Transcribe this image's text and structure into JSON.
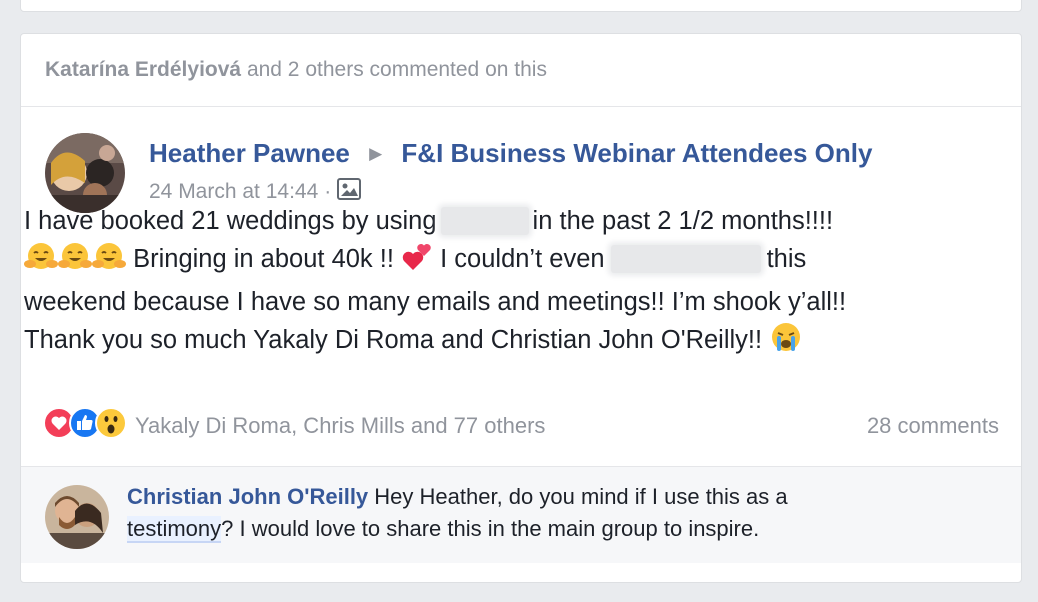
{
  "activity": {
    "actor": "Katarína Erdélyiová",
    "suffix": "and 2 others commented on this"
  },
  "post": {
    "author": "Heather Pawnee",
    "group": "F&I Business Webinar Attendees Only",
    "timestamp": "24 March at 14:44",
    "separator": "·",
    "privacy_icon": "photo-privacy-icon",
    "text": {
      "part1": "I have booked 21 weddings by using",
      "part2": "in the past 2 1/2 months!!!!",
      "part3": "Bringing in about 40k !!",
      "part4": "I couldn’t even",
      "part5": "this",
      "part6": "weekend because I have so many emails and meetings!! I’m shook y’all!!",
      "part7": "Thank you so much Yakaly Di Roma and Christian John O'Reilly!!"
    }
  },
  "reactions": {
    "icons": [
      "love-reaction-icon",
      "like-reaction-icon",
      "wow-reaction-icon"
    ],
    "names": "Yakaly Di Roma, Chris Mills and 77 others",
    "comments": "28 comments"
  },
  "comment": {
    "author": "Christian John O'Reilly",
    "text1": "Hey Heather, do you mind if I use this as a",
    "mention": "testimony",
    "text2": "? I would love to share this in the main group to inspire."
  },
  "colors": {
    "link": "#365899",
    "muted": "#90949c",
    "love": "#f33e58",
    "like": "#1877f2",
    "wow": "#fcc93c"
  }
}
